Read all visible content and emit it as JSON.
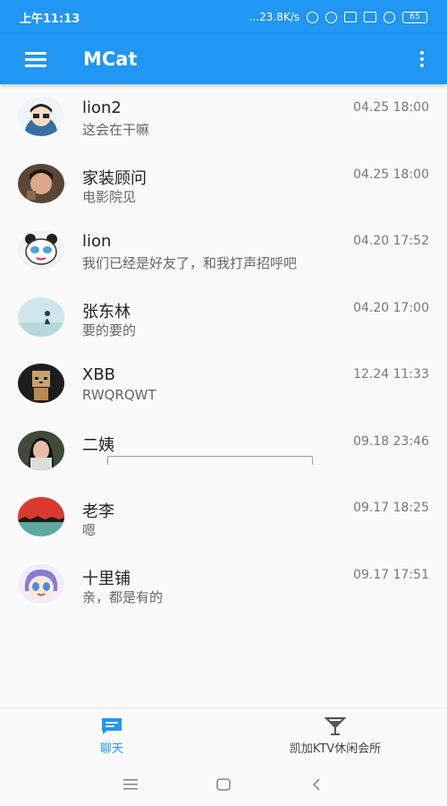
{
  "status_bar": {
    "time": "上午11:13",
    "speed": "...23.8K/s",
    "battery": "65"
  },
  "app_bar": {
    "title": "MCat",
    "color": "#2196f3"
  },
  "chats": [
    {
      "name": "lion2",
      "message": "这会在干嘛",
      "time": "04.25 18:00",
      "avatar": "boy-cartoon-avatar"
    },
    {
      "name": "家装顾问",
      "message": "电影院见",
      "time": "04.25 18:00",
      "avatar": "photo-avatar"
    },
    {
      "name": "lion",
      "message": "我们已经是好友了，和我打声招呼吧",
      "time": "04.20 17:52",
      "avatar": "panda-avatar"
    },
    {
      "name": "张东林",
      "message": "要的要的",
      "time": "04.20 17:00",
      "avatar": "landscape-avatar"
    },
    {
      "name": "XBB",
      "message": "RWQRQWT",
      "time": "12.24 11:33",
      "avatar": "box-robot-avatar"
    },
    {
      "name": "二姨",
      "message": "",
      "time": "09.18 23:46",
      "avatar": "girl-photo-avatar"
    },
    {
      "name": "老李",
      "message": "嗯",
      "time": "09.17 18:25",
      "avatar": "sunset-avatar"
    },
    {
      "name": "十里铺",
      "message": "亲，都是有的",
      "time": "09.17 17:51",
      "avatar": "anime-girl-avatar"
    }
  ],
  "bottom_nav": {
    "chat_label": "聊天",
    "ktv_label": "凯加KTV休闲会所"
  }
}
